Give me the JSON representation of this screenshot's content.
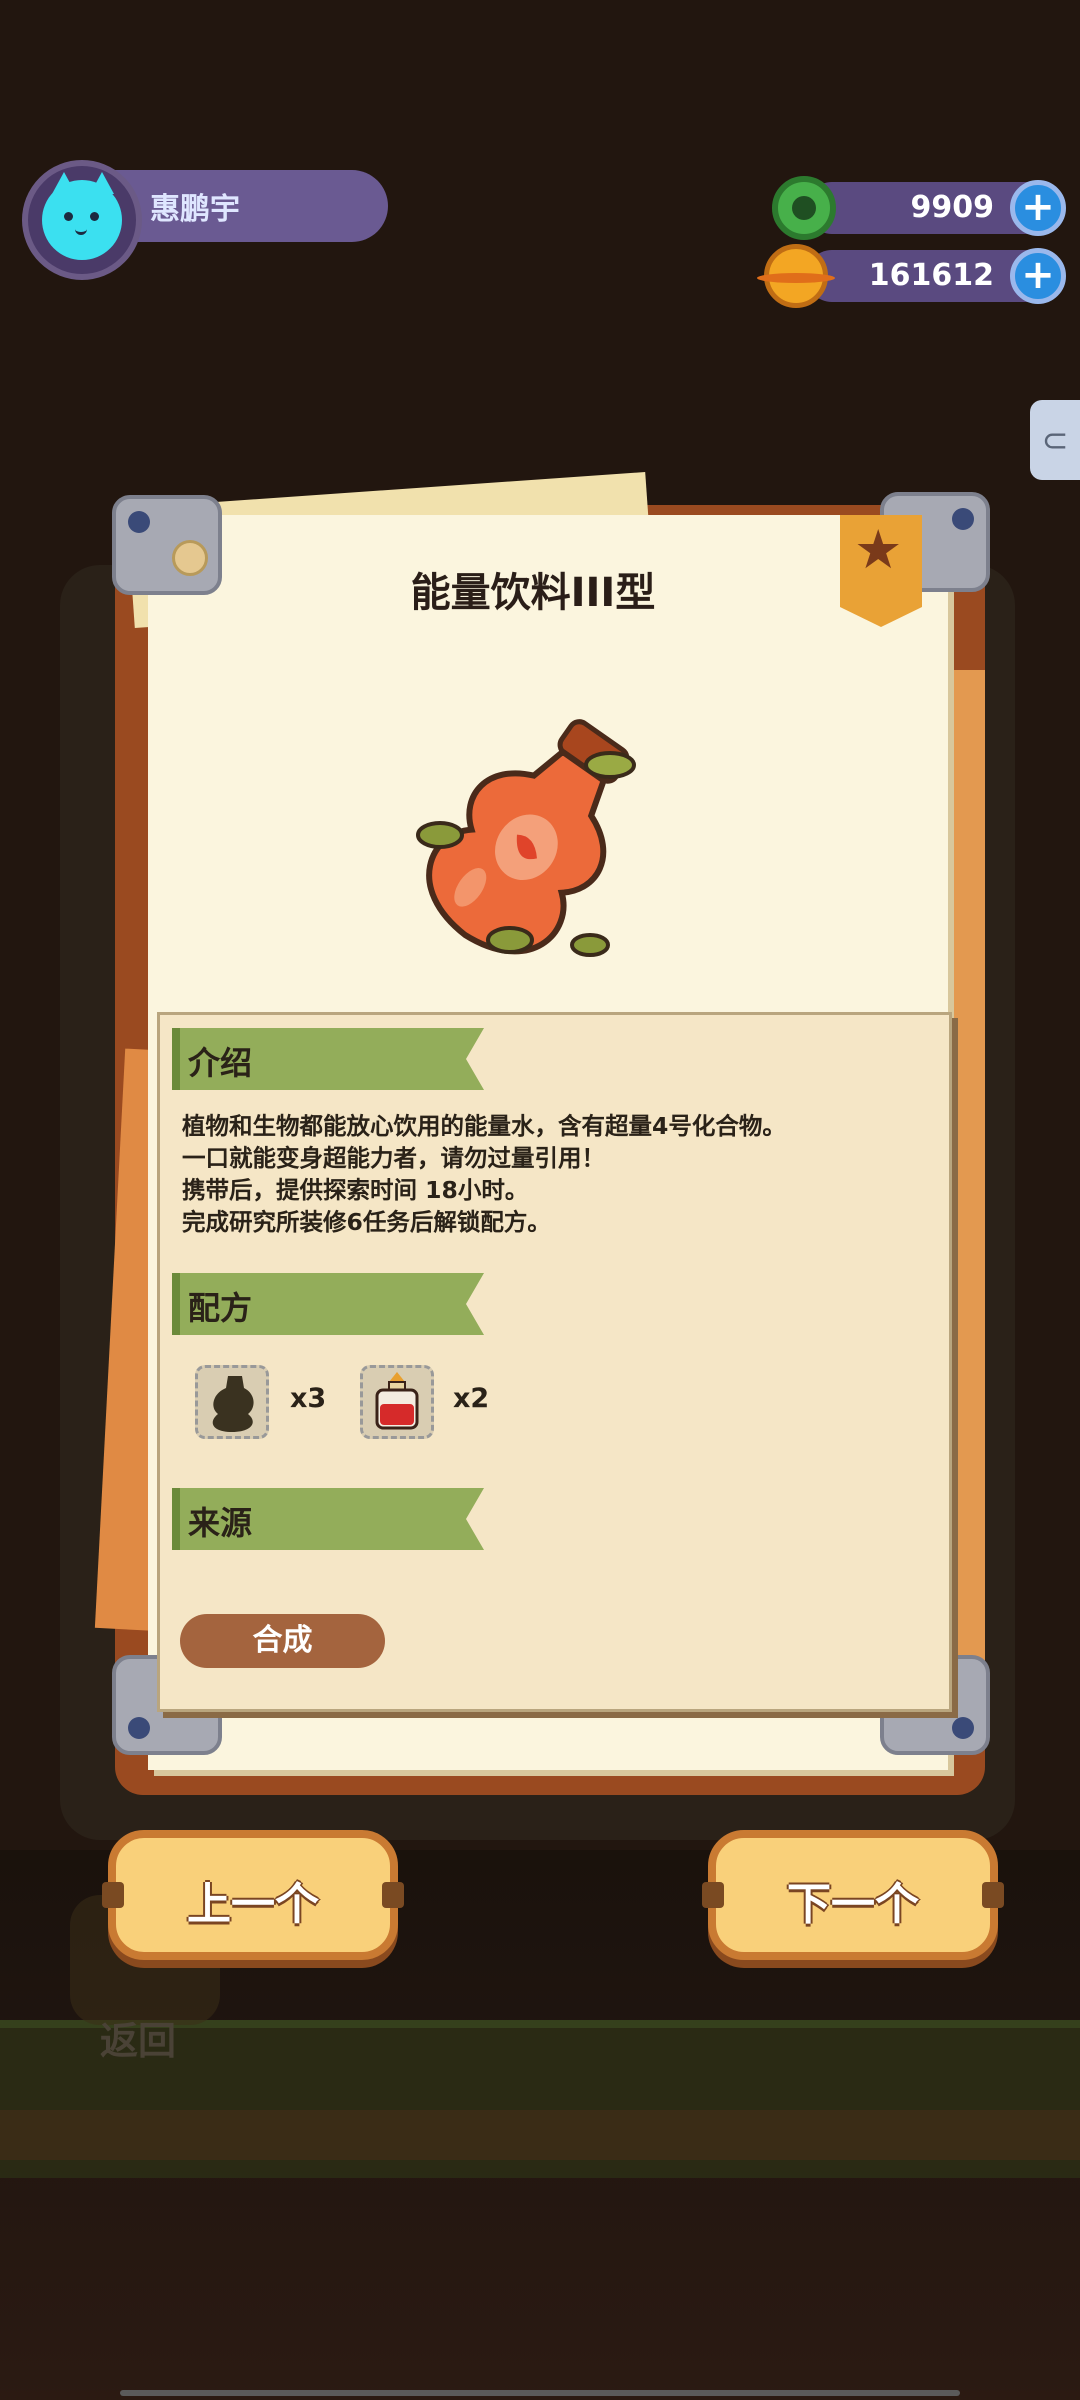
{
  "player": {
    "name": "惠鹏宇"
  },
  "currency": [
    {
      "id": "gems",
      "value": "9909",
      "icon": "green-ring-coin-icon",
      "color": "#47b04a"
    },
    {
      "id": "coins",
      "value": "161612",
      "icon": "gold-planet-coin-icon",
      "color": "#f3a623"
    }
  ],
  "item": {
    "title": "能量饮料III型",
    "image": "orange-energy-drink-bottle"
  },
  "sections": {
    "intro": "介绍",
    "recipe": "配方",
    "source": "来源"
  },
  "description": [
    "植物和生物都能放心饮用的能量水，含有超量4号化合物。",
    "一口就能变身超能力者，请勿过量引用！",
    "携带后，提供探索时间 18小时。",
    "完成研究所装修6任务后解锁配方。"
  ],
  "recipe": [
    {
      "icon": "dark-bottle-icon",
      "count": "x3"
    },
    {
      "icon": "red-potion-icon",
      "count": "x2"
    }
  ],
  "buttons": {
    "craft": "合成",
    "prev": "上一个",
    "next": "下一个",
    "back": "返回"
  }
}
